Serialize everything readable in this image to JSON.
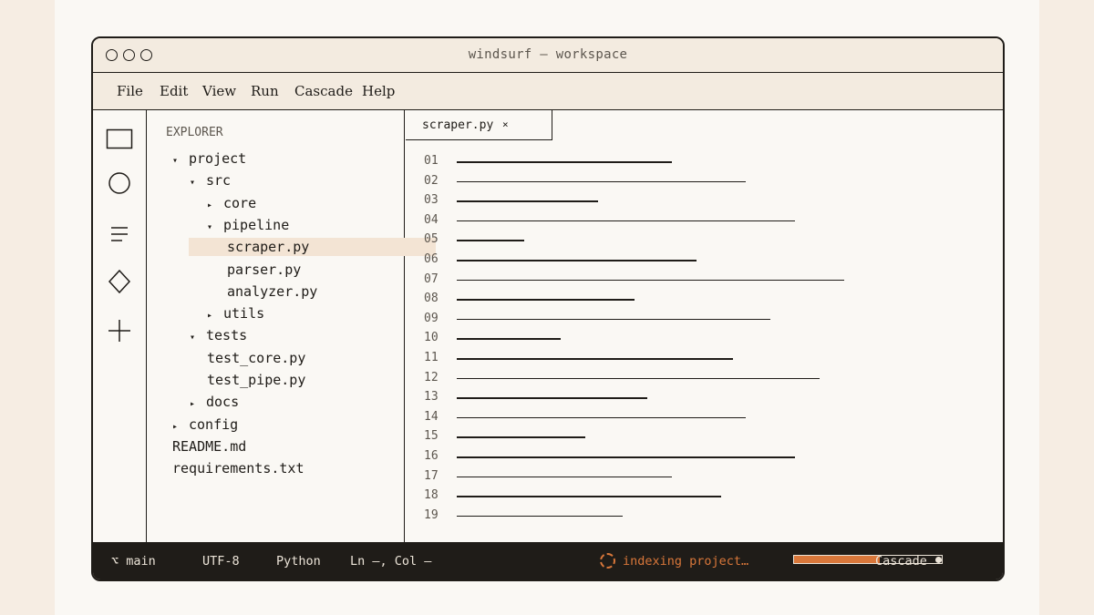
{
  "window": {
    "title": "windsurf — workspace"
  },
  "menu": [
    "File",
    "Edit",
    "View",
    "Run",
    "Cascade",
    "Help"
  ],
  "activity_bar": [
    "files-icon",
    "search-icon",
    "source-control-icon",
    "extensions-icon",
    "new-icon"
  ],
  "explorer": {
    "title": "EXPLORER",
    "items": [
      {
        "label": "project",
        "arrow": "▾",
        "selected": false
      },
      {
        "label": "src",
        "arrow": "▾",
        "selected": false
      },
      {
        "label": "core",
        "arrow": "▸",
        "selected": false
      },
      {
        "label": "pipeline",
        "arrow": "▾",
        "selected": false
      },
      {
        "label": "scraper.py",
        "arrow": "",
        "selected": true
      },
      {
        "label": "parser.py",
        "arrow": "",
        "selected": false
      },
      {
        "label": "analyzer.py",
        "arrow": "",
        "selected": false
      },
      {
        "label": "utils",
        "arrow": "▸",
        "selected": false
      },
      {
        "label": "tests",
        "arrow": "▾",
        "selected": false
      },
      {
        "label": "test_core.py",
        "arrow": "",
        "selected": false
      },
      {
        "label": "test_pipe.py",
        "arrow": "",
        "selected": false
      },
      {
        "label": "docs",
        "arrow": "▸",
        "selected": false
      },
      {
        "label": "config",
        "arrow": "▸",
        "selected": false
      },
      {
        "label": "README.md",
        "arrow": "",
        "selected": false
      },
      {
        "label": "requirements.txt",
        "arrow": "",
        "selected": false
      }
    ]
  },
  "editor": {
    "tab": {
      "label": "scraper.py",
      "close": "×"
    },
    "line_numbers": [
      "01",
      "02",
      "03",
      "04",
      "05",
      "06",
      "07",
      "08",
      "09",
      "10",
      "11",
      "12",
      "13",
      "14",
      "15",
      "16",
      "17",
      "18",
      "19"
    ]
  },
  "status": {
    "branch": "⌥ main",
    "encoding": "UTF-8",
    "language": "Python",
    "position": "Ln —, Col —",
    "indexing": "indexing project…",
    "cascade": "Cascade",
    "progress": 0.58,
    "accent_color": "#d9773a"
  }
}
